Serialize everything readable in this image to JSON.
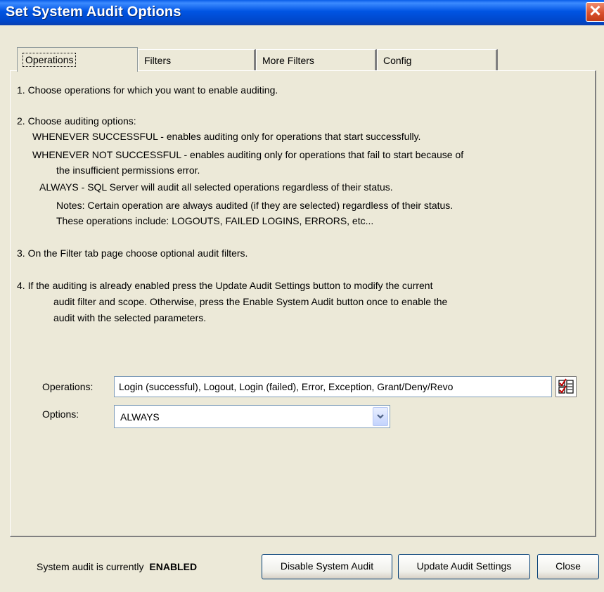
{
  "window": {
    "title": "Set System Audit Options",
    "close_glyph": "✕"
  },
  "tabs": [
    {
      "label": "Operations",
      "active": true
    },
    {
      "label": "Filters",
      "active": false
    },
    {
      "label": "More Filters",
      "active": false
    },
    {
      "label": "Config",
      "active": false
    }
  ],
  "instructions": {
    "step1": "1.  Choose operations for which you want to enable auditing.",
    "step2_title": "2.  Choose auditing options:",
    "step2_successful": "WHENEVER SUCCESSFUL - enables auditing only for operations that start successfully.",
    "step2_not_successful": "WHENEVER NOT SUCCESSFUL - enables auditing only for operations that fail to start because of",
    "step2_not_successful_cont": "the insufficient permissions error.",
    "step2_always": "ALWAYS - SQL Server will audit all selected operations regardless of their status.",
    "notes_line1": "Notes:   Certain operation are always audited (if they are selected) regardless of their status.",
    "notes_line2": "These operations include: LOGOUTS, FAILED LOGINS, ERRORS, etc...",
    "step3": "3.  On the Filter tab page choose optional audit filters.",
    "step4_line1": "4.  If the auditing is already enabled press the Update Audit Settings button to modify the current",
    "step4_line2": "audit filter and scope. Otherwise, press the Enable System Audit button once to enable the",
    "step4_line3": "audit with the selected parameters."
  },
  "fields": {
    "operations_label": "Operations:",
    "operations_value": "Login (successful), Logout, Login (failed), Error, Exception, Grant/Deny/Revo",
    "operations_button_icon": "checklist-icon",
    "options_label": "Options:",
    "options_value": "ALWAYS",
    "options_dropdown_icon": "chevron-down-icon"
  },
  "footer": {
    "status_prefix": "System audit is currently",
    "status_value": "ENABLED",
    "disable_button": "Disable System Audit",
    "update_button": "Update Audit Settings",
    "close_button": "Close"
  },
  "colors": {
    "titlebar": "#0054e3",
    "dialog_background": "#ece9d8",
    "close_button": "#d9502d"
  }
}
